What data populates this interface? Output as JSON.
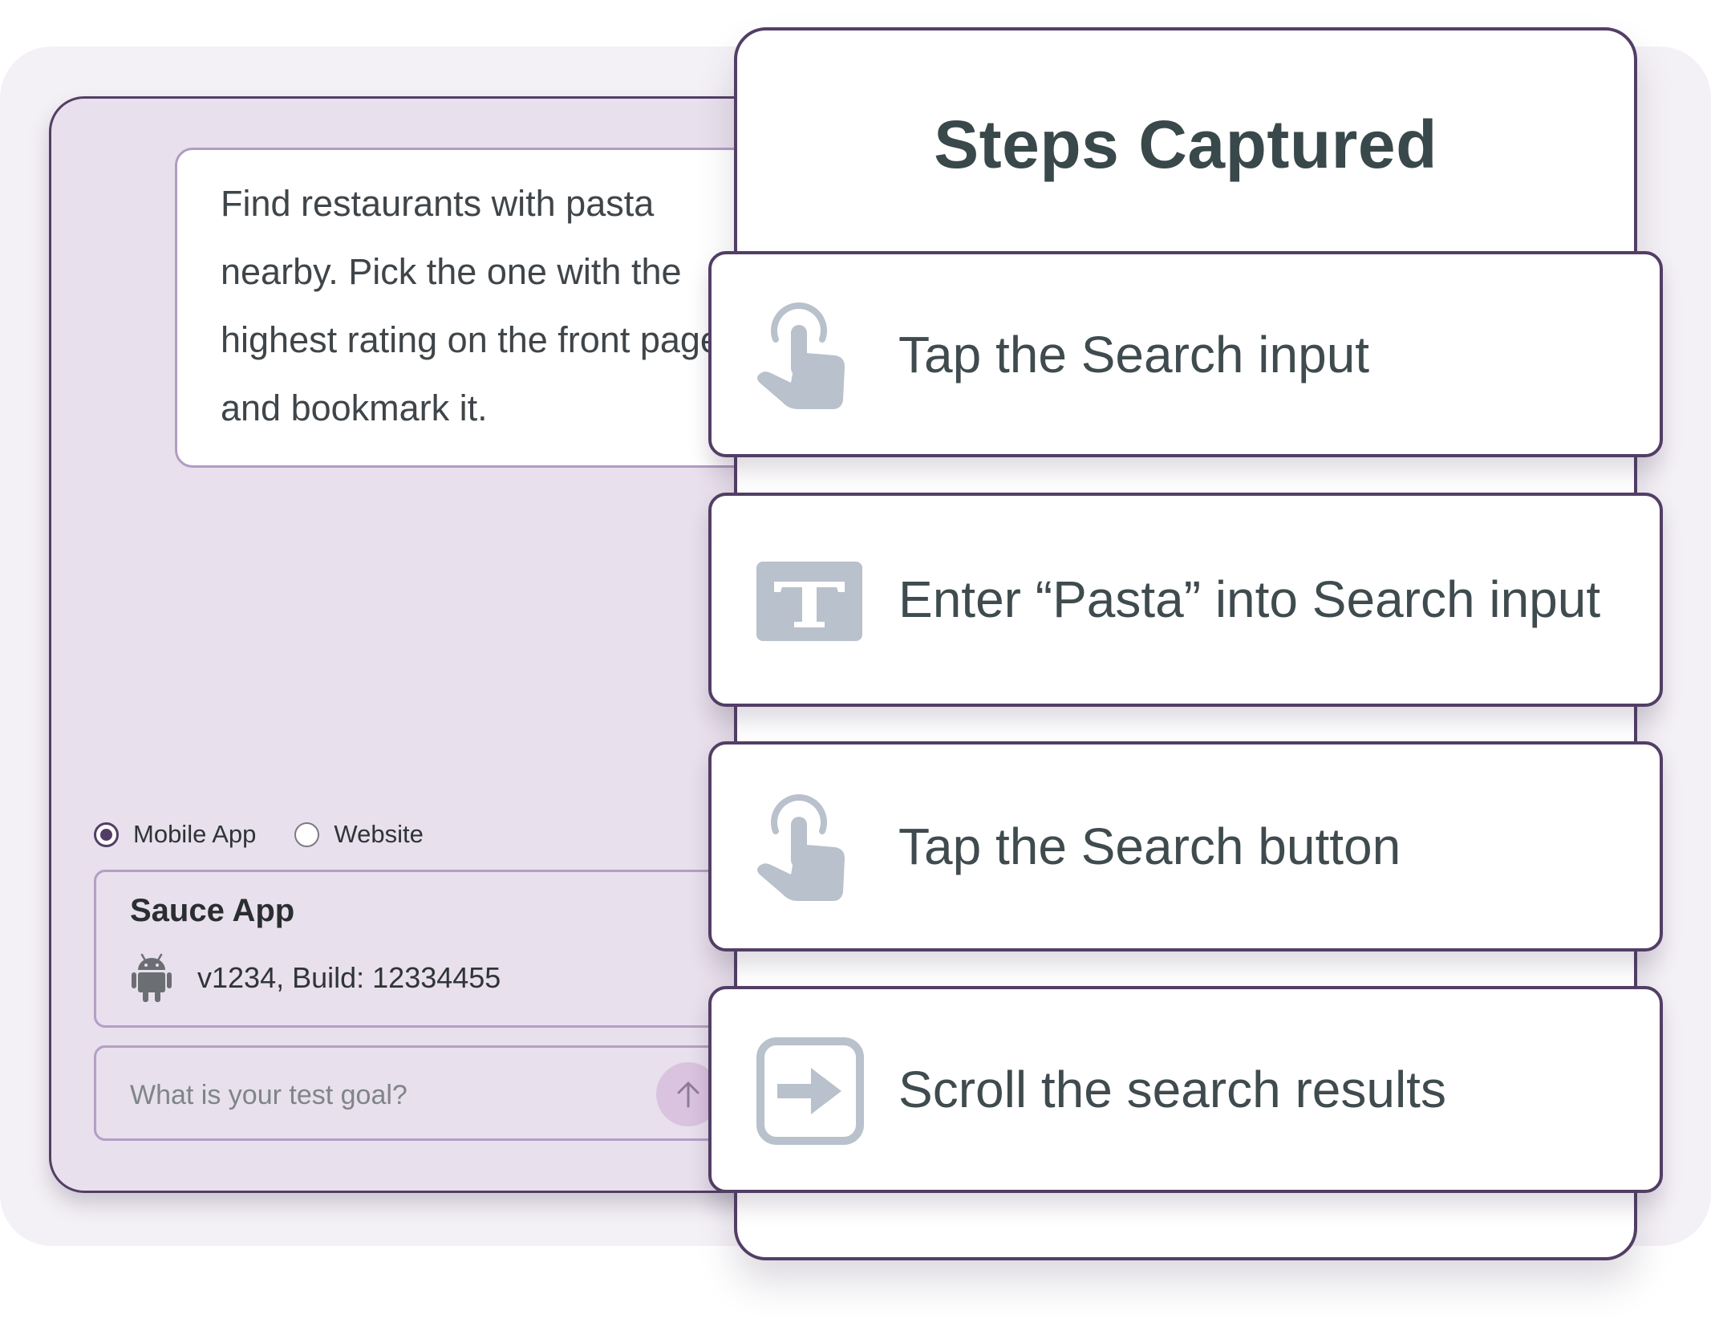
{
  "prompt": {
    "text": "Find restaurants with pasta nearby. Pick the one with the highest rating on the front page and bookmark it."
  },
  "platform": {
    "options": [
      {
        "label": "Mobile App",
        "selected": true
      },
      {
        "label": "Website",
        "selected": false
      }
    ]
  },
  "app": {
    "name": "Sauce App",
    "version": "v1234, Build: 12334455",
    "platform_icon": "android-icon"
  },
  "goal_input": {
    "value": "",
    "placeholder": "What is your test goal?",
    "submit_icon": "arrow-up-icon"
  },
  "steps_panel": {
    "title": "Steps Captured",
    "steps": [
      {
        "label": "Tap the Search input",
        "icon": "tap-icon"
      },
      {
        "label": "Enter “Pasta” into Search input",
        "icon": "text-input-icon"
      },
      {
        "label": "Tap the Search button",
        "icon": "tap-icon"
      },
      {
        "label": "Scroll the search results",
        "icon": "scroll-icon"
      }
    ]
  },
  "colors": {
    "accent": "#523e65",
    "panel_bg": "#e8e0ec",
    "icon_gray": "#b8c1cc",
    "text_dark": "#3f4b4e"
  }
}
